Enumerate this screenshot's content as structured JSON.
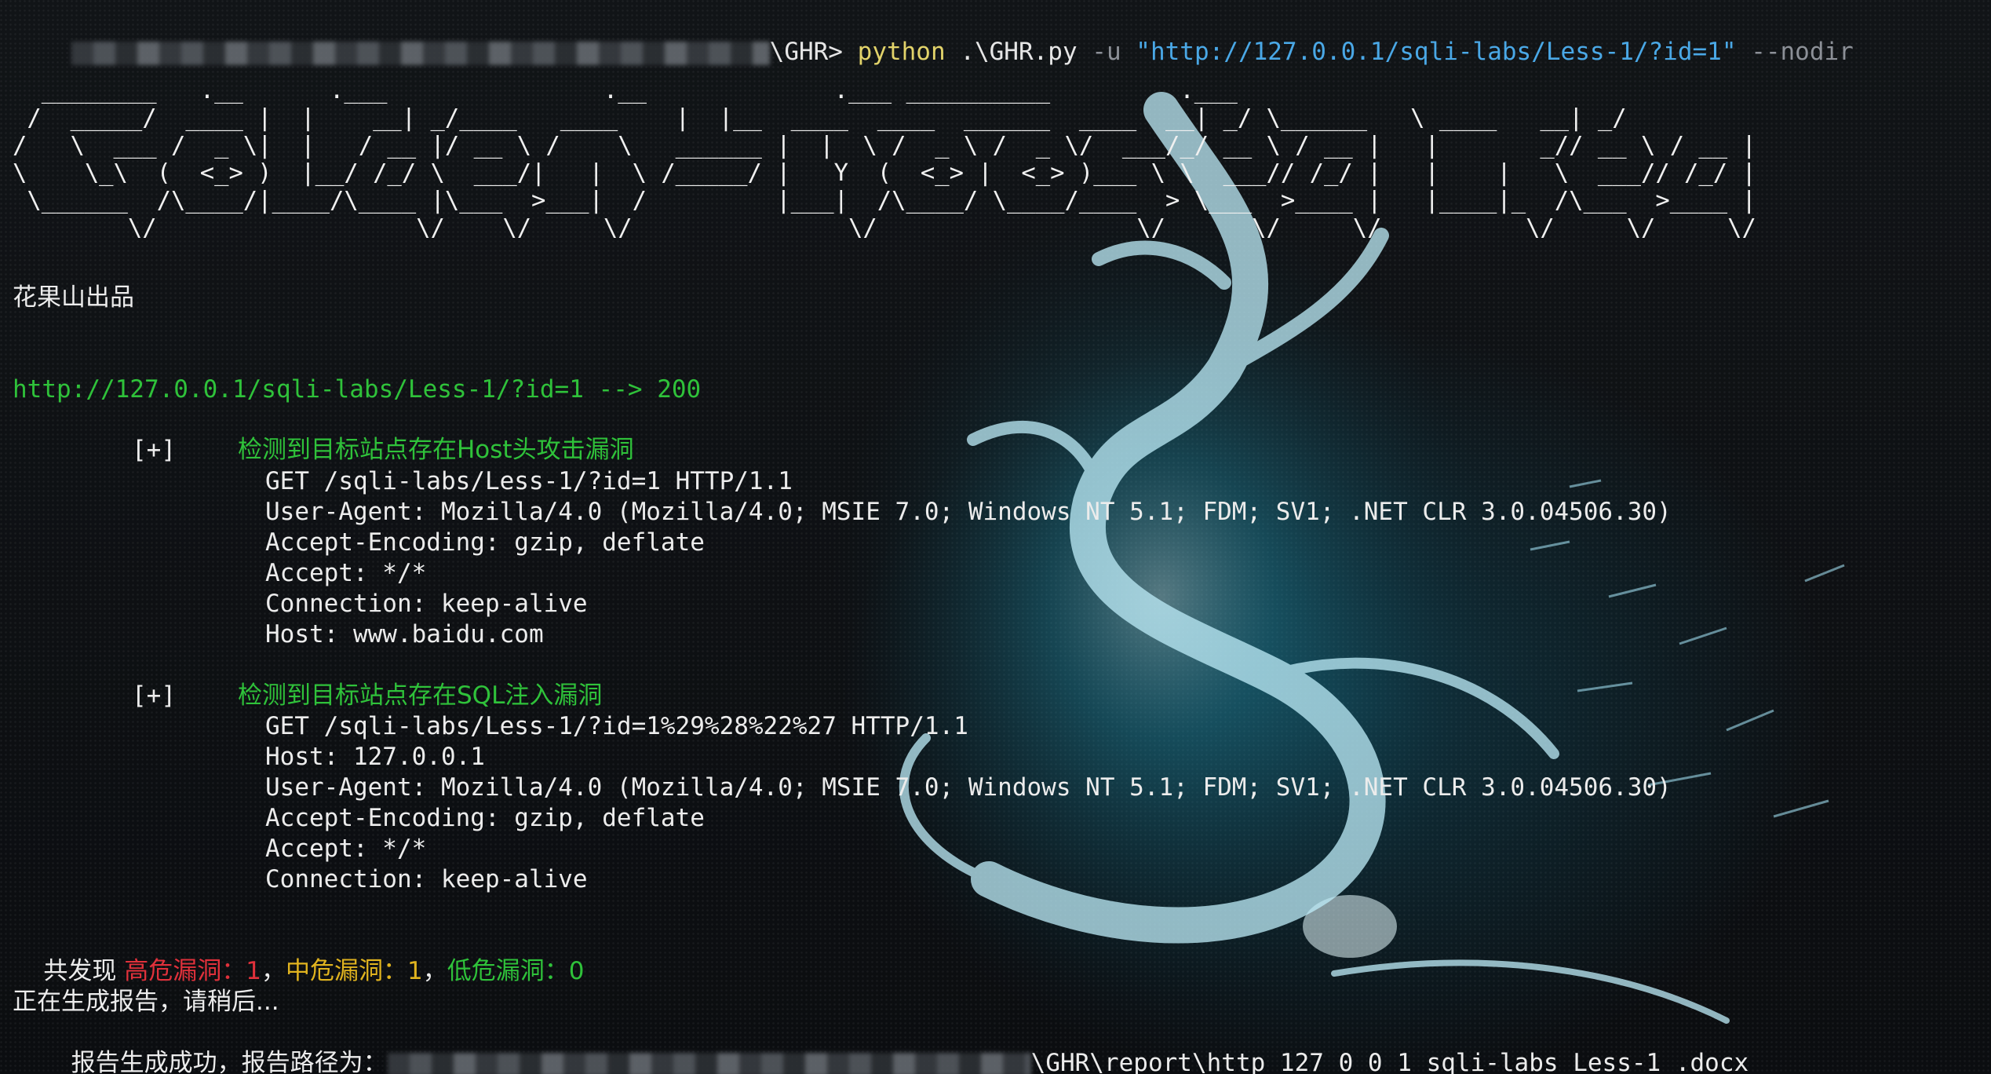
{
  "command_line": {
    "prompt_suffix": "\\GHR>",
    "program": "python",
    "script": ".\\GHR.py",
    "flag_u": "-u",
    "url": "\"http://127.0.0.1/sqli-labs/Less-1/?id=1\"",
    "flag_nodir": "--nodir"
  },
  "banner_ascii": "  ________   .__      .___               .__             .___ __________         .___\n /  _____/  ____ |  |    __| _/____   ____    |  |__  ____  ____  ______  ____  __| _/ \\______   \\ ____   __| _/\n/   \\  ___ /  _ \\|  |   / __ |/ __ \\ /    \\   ______ |  |  \\ /  _ \\ /  _ \\/  ___/_/ __ \\ / __ |   |       _// __ \\ / __ |\n\\    \\_\\  (  <_> )  |__/ /_/ \\  ___/|   |  \\ /_____/ |   Y  (  <_> |  <_> )___ \\ \\  ___// /_/ |   |    |   \\  ___// /_/ |\n \\______  /\\____/|____/\\____ |\\___  >___|  /         |___|  /\\____/ \\____/____  > \\___  >____ |   |____|_  /\\___  >____ |\n        \\/                  \\/    \\/     \\/               \\/                  \\/      \\/     \\/          \\/     \\/     \\/",
  "credit": "花果山出品",
  "status_line": "http://127.0.0.1/sqli-labs/Less-1/?id=1 --> 200",
  "findings": [
    {
      "marker": "[+]",
      "title": "检测到目标站点存在Host头攻击漏洞",
      "request_lines": [
        "GET /sqli-labs/Less-1/?id=1 HTTP/1.1",
        "User-Agent: Mozilla/4.0 (Mozilla/4.0; MSIE 7.0; Windows NT 5.1; FDM; SV1; .NET CLR 3.0.04506.30)",
        "Accept-Encoding: gzip, deflate",
        "Accept: */*",
        "Connection: keep-alive",
        "Host: www.baidu.com"
      ]
    },
    {
      "marker": "[+]",
      "title": "检测到目标站点存在SQL注入漏洞",
      "request_lines": [
        "GET /sqli-labs/Less-1/?id=1%29%28%22%27 HTTP/1.1",
        "Host: 127.0.0.1",
        "User-Agent: Mozilla/4.0 (Mozilla/4.0; MSIE 7.0; Windows NT 5.1; FDM; SV1; .NET CLR 3.0.04506.30)",
        "Accept-Encoding: gzip, deflate",
        "Accept: */*",
        "Connection: keep-alive"
      ]
    }
  ],
  "summary": {
    "prefix": "共发现 ",
    "high_label": "高危漏洞：1",
    "sep1": "，",
    "medium_label": "中危漏洞：1",
    "sep2": "，",
    "low_label": "低危漏洞：0"
  },
  "report_generating": "正在生成报告，请稍后...",
  "report_done_prefix": "报告生成成功，报告路径为：",
  "report_path_suffix": "\\GHR\\report\\http_127_0_0_1_sqli-labs_Less-1_.docx",
  "colors": {
    "green": "#2fc23a",
    "high": "#e0313b",
    "medium": "#e0b31f",
    "low": "#2fc23a",
    "command_python": "#e2d36a",
    "command_url": "#4aa8e6",
    "accent_glow": "#1fb4d6"
  }
}
